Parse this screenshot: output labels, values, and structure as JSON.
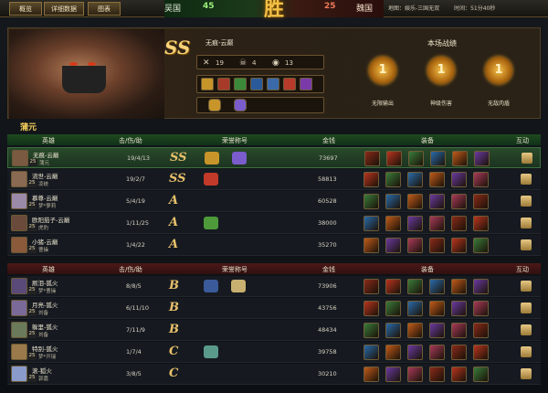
{
  "tabs": [
    "概览",
    "详细数据",
    "图表"
  ],
  "scoreboard": {
    "left_team": "吴国",
    "left_score": "45",
    "right_team": "魏国",
    "right_score": "25",
    "center_glyph": "胜"
  },
  "match_info": {
    "map": "地图：娱乐-三国无双",
    "time": "时间：51分40秒"
  },
  "hero_panel": {
    "grade": "SS",
    "name": "无痕-云巅",
    "kills": "19",
    "deaths": "4",
    "assists": "13",
    "performance_title": "本场战绩",
    "medals": [
      {
        "number": "1",
        "label": "无限输出"
      },
      {
        "number": "1",
        "label": "神级伤害"
      },
      {
        "number": "1",
        "label": "无敌肉盾"
      }
    ]
  },
  "player_name": "蒲元",
  "columns": {
    "hero": "英雄",
    "kda": "击/伤/助",
    "honor": "荣誉称号",
    "money": "金钱",
    "equip": "装备",
    "interact": "互动"
  },
  "winning_team": [
    {
      "name": "无痕-云巅",
      "level": "25",
      "player": "蒲元",
      "kda": "19/4/13",
      "grade": "SS",
      "money": "73697",
      "avatar": "#7a5a40",
      "honors": [
        "#c8952a",
        "#7a5ccc"
      ]
    },
    {
      "name": "流世-云巅",
      "level": "25",
      "player": "凌统",
      "kda": "19/2/7",
      "grade": "SS",
      "money": "58813",
      "avatar": "#8a6a52",
      "honors": [
        "#c23a2a"
      ]
    },
    {
      "name": "慕尊-云巅",
      "level": "25",
      "player": "梦*萝莉",
      "kda": "5/4/19",
      "grade": "A",
      "money": "60528",
      "avatar": "#9a8aa8",
      "honors": []
    },
    {
      "name": "欧阳茄子-云巅",
      "level": "25",
      "player": "虎豹",
      "kda": "1/11/25",
      "grade": "A",
      "money": "38000",
      "avatar": "#6a4a3a",
      "honors": [
        "#4e9a3a"
      ]
    },
    {
      "name": "小猪-云巅",
      "level": "25",
      "player": "曹操",
      "kda": "1/4/22",
      "grade": "A",
      "money": "35270",
      "avatar": "#8a5a3a",
      "honors": []
    }
  ],
  "losing_team": [
    {
      "name": "厕泪-狐火",
      "level": "25",
      "player": "梦*曹操",
      "kda": "8/8/5",
      "grade": "B",
      "money": "73906",
      "avatar": "#5a4a7a",
      "honors": [
        "#3a5a9a",
        "#c8b070"
      ]
    },
    {
      "name": "月亮-狐火",
      "level": "25",
      "player": "刘备",
      "kda": "6/11/10",
      "grade": "B",
      "money": "43756",
      "avatar": "#7a6a9a",
      "honors": []
    },
    {
      "name": "躲里-狐火",
      "level": "25",
      "player": "刘备",
      "kda": "7/11/9",
      "grade": "B",
      "money": "48434",
      "avatar": "#6a7a5a",
      "honors": []
    },
    {
      "name": "特别-狐火",
      "level": "25",
      "player": "梦*开瑞",
      "kda": "1/7/4",
      "grade": "C",
      "money": "39758",
      "avatar": "#9a7a4a",
      "honors": [
        "#5a9a8a"
      ]
    },
    {
      "name": "滚-狐火",
      "level": "25",
      "player": "郭嘉",
      "kda": "3/8/5",
      "grade": "C",
      "money": "30210",
      "avatar": "#8a9aca",
      "honors": []
    }
  ],
  "equip_colors": [
    "#8a2a1a",
    "#b8341f",
    "#3a7a3a",
    "#2a6aa8",
    "#c05a1a",
    "#6a3aa0",
    "#a83a5a"
  ]
}
